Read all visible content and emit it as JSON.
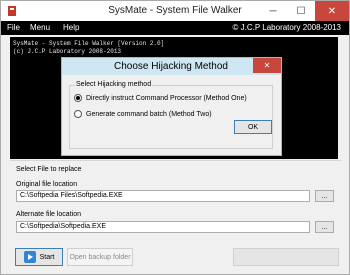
{
  "window": {
    "title": "SysMate - System File Walker",
    "minimize": "─",
    "maximize": "☐",
    "close": "✕"
  },
  "menubar": {
    "items": [
      "File",
      "Menu",
      "Help"
    ],
    "copyright": "© J.C.P Laboratory 2008-2013"
  },
  "console": {
    "lines": [
      "SysMate - System File Walker [Version 2.0]",
      "(c) J.C.P Laboratory 2008-2013"
    ]
  },
  "dialog": {
    "title": "Choose Hijacking Method",
    "close": "✕",
    "group_label": "Select Hijacking method",
    "options": [
      "Directly instruct Command Processor (Method One)",
      "Generate command batch (Method Two)"
    ],
    "selected_index": 0,
    "ok_label": "OK"
  },
  "file_section": {
    "title": "Select File to replace",
    "original_label": "Original file location",
    "original_value": "C:\\Softpedia Files\\Softpedia.EXE",
    "alternate_label": "Alternate file location",
    "alternate_value": "C:\\Softpedia\\Softpedia.EXE",
    "browse_label": "..."
  },
  "buttons": {
    "start": "Start",
    "backup": "Open backup folder"
  },
  "icons": {
    "app": "app-icon",
    "start": "play-icon"
  }
}
